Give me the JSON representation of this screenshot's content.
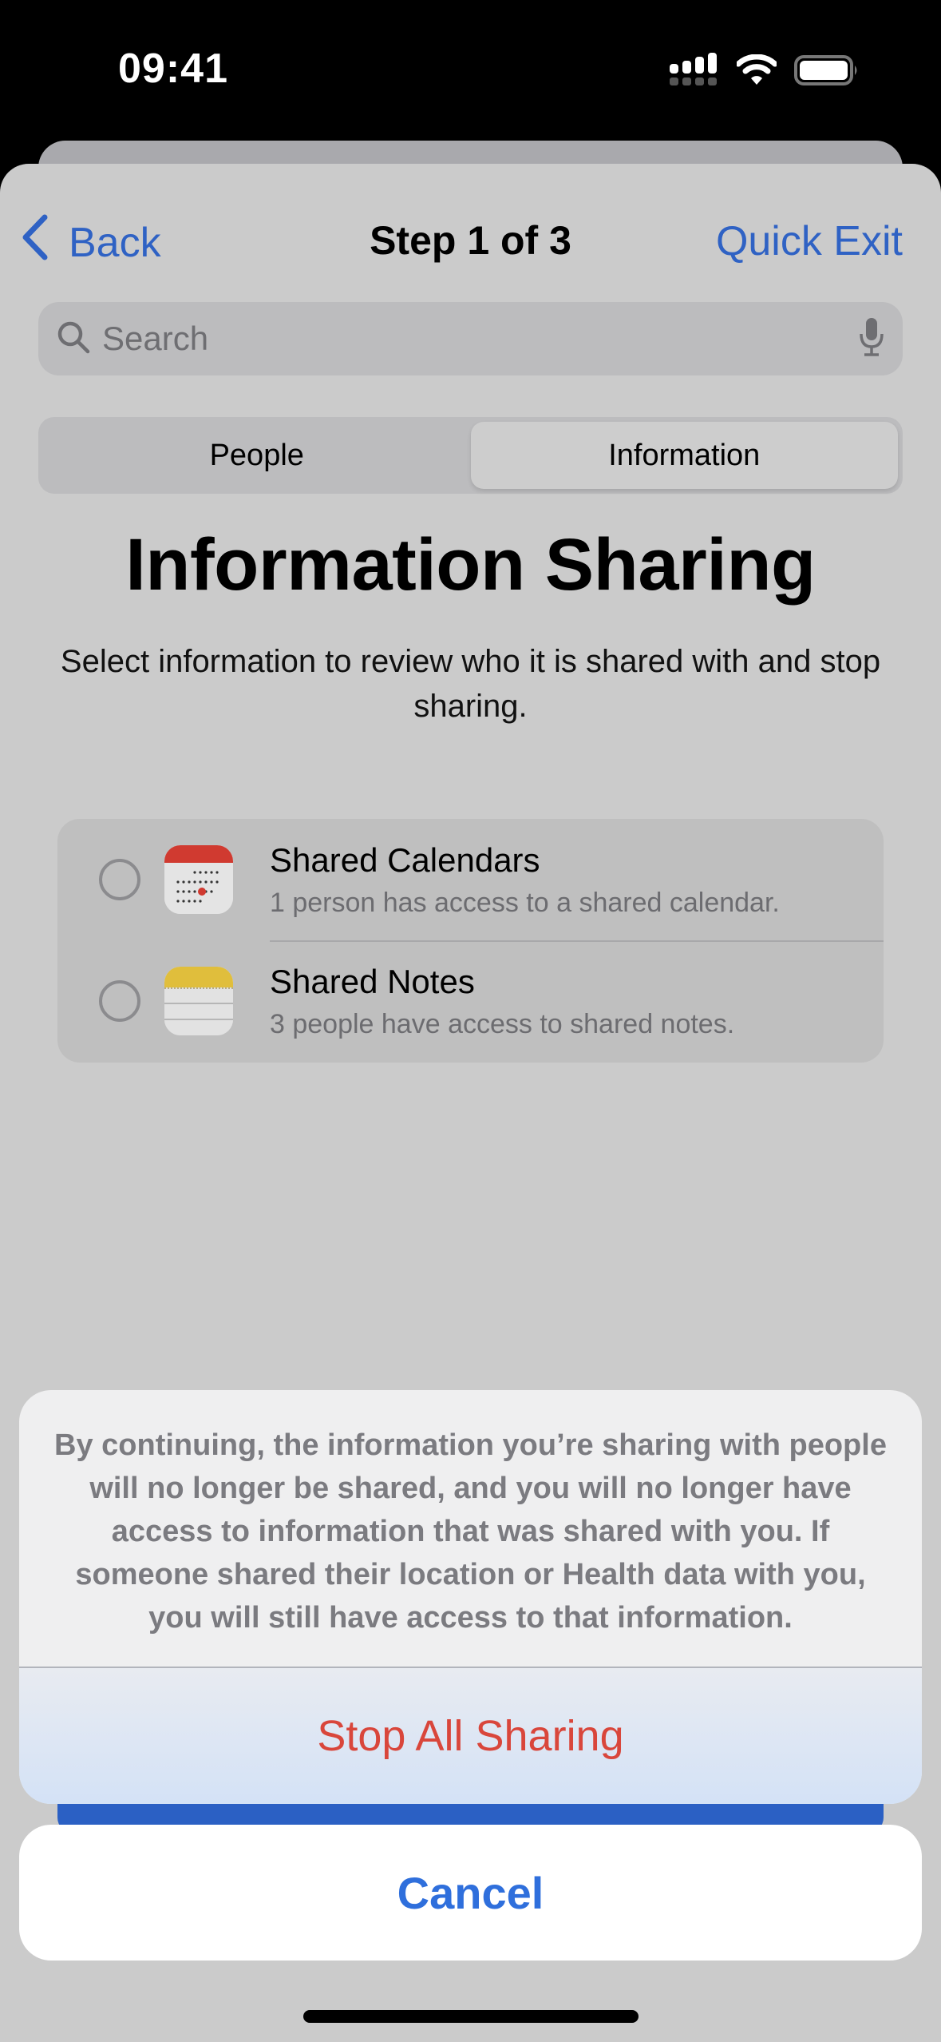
{
  "status_bar": {
    "time": "09:41",
    "icons": [
      "cellular-signal-icon",
      "wifi-icon",
      "battery-icon"
    ]
  },
  "nav": {
    "back_label": "Back",
    "title": "Step 1 of 3",
    "quick_exit_label": "Quick Exit"
  },
  "search": {
    "placeholder": "Search",
    "value": ""
  },
  "segmented": {
    "tabs": [
      {
        "label": "People",
        "selected": false
      },
      {
        "label": "Information",
        "selected": true
      }
    ]
  },
  "page": {
    "title": "Information Sharing",
    "subtitle": "Select information to review who it is shared with and stop sharing."
  },
  "list": {
    "items": [
      {
        "title": "Shared Calendars",
        "subtitle": "1 person has access to a shared calendar.",
        "icon": "calendar-app-icon",
        "selected": false
      },
      {
        "title": "Shared Notes",
        "subtitle": "3 people have access to shared notes.",
        "icon": "notes-app-icon",
        "selected": false
      }
    ]
  },
  "action_sheet": {
    "message": "By continuing, the information you’re sharing with people will no longer be shared, and you will no longer have access to information that was shared with you. If someone shared their location or Health data with you, you will still have access to that information.",
    "destructive_label": "Stop All Sharing",
    "cancel_label": "Cancel"
  },
  "colors": {
    "accent": "#2f62c4",
    "destructive": "#d9463b",
    "calendar_red": "#d03a30",
    "notes_yellow": "#e0be3c"
  }
}
